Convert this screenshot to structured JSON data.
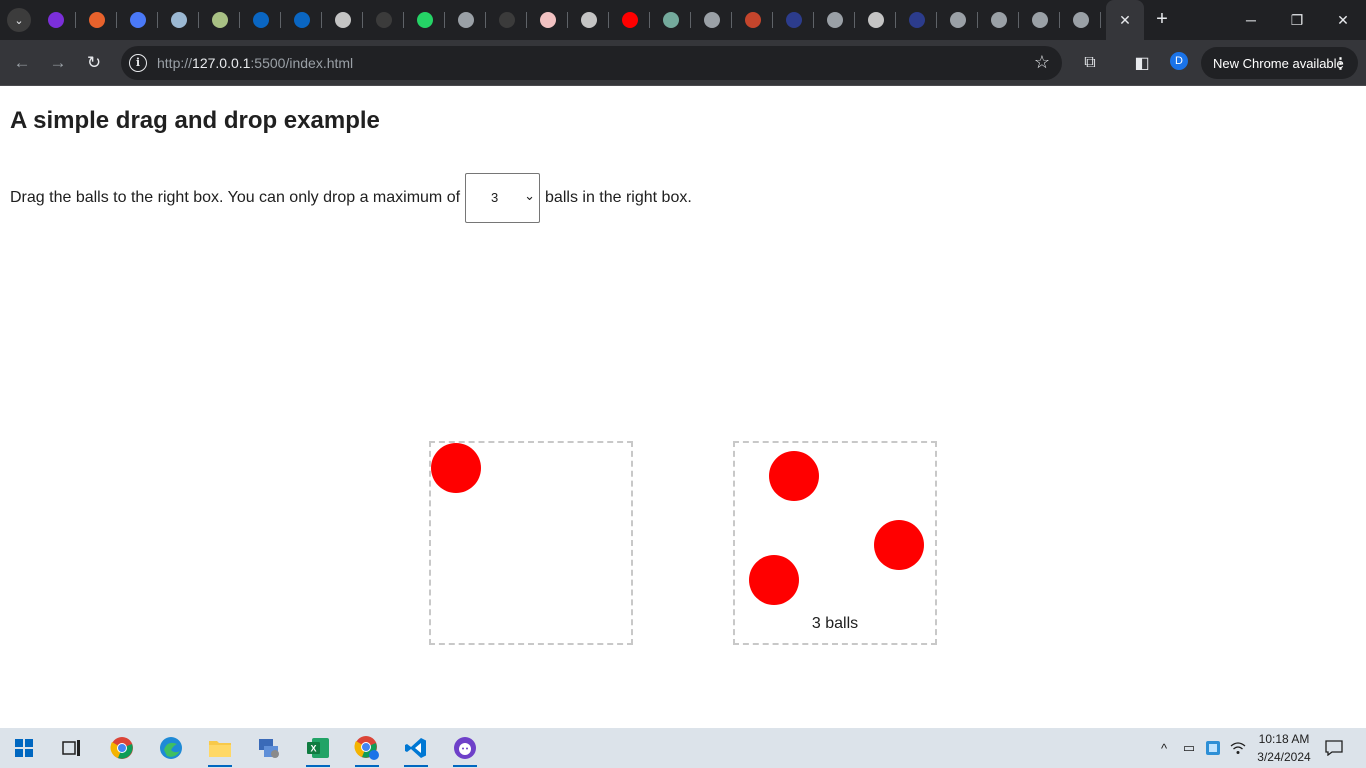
{
  "browser": {
    "tabs": [
      {
        "icon": "tab-list-icon"
      },
      {
        "icon": "mail-icon",
        "color": "#7b2fd9"
      },
      {
        "icon": "orange-circle-icon",
        "color": "#e8622c"
      },
      {
        "icon": "dots-icon",
        "color": "#4a79f7"
      },
      {
        "icon": "globe-icon",
        "color": "#9bb8d3"
      },
      {
        "icon": "globe-icon",
        "color": "#a8c084"
      },
      {
        "icon": "linkedin-icon",
        "color": "#0a66c2"
      },
      {
        "icon": "linkedin-icon",
        "color": "#0a66c2"
      },
      {
        "icon": "crosshair-icon",
        "color": "#c4c4c4"
      },
      {
        "icon": "github-icon",
        "color": "#3b3b3b"
      },
      {
        "icon": "whatsapp-icon",
        "color": "#25d366"
      },
      {
        "icon": "circle-icon",
        "color": "#9aa0a6"
      },
      {
        "icon": "github-icon",
        "color": "#3b3b3b"
      },
      {
        "icon": "image-icon",
        "color": "#f1c2c2"
      },
      {
        "icon": "globe-icon",
        "color": "#c4c4c4"
      },
      {
        "icon": "youtube-icon",
        "color": "#ff0000"
      },
      {
        "icon": "chatgpt-icon",
        "color": "#74aa9c"
      },
      {
        "icon": "circle-icon",
        "color": "#9aa0a6"
      },
      {
        "icon": "orange-circle-icon",
        "color": "#c4452c"
      },
      {
        "icon": "crown-icon",
        "color": "#2c3c8c"
      },
      {
        "icon": "circle-icon",
        "color": "#9aa0a6"
      },
      {
        "icon": "globe-icon",
        "color": "#c4c4c4"
      },
      {
        "icon": "crown-icon",
        "color": "#2c3c8c"
      },
      {
        "icon": "globe-icon",
        "color": "#9aa0a6"
      },
      {
        "icon": "globe-icon",
        "color": "#9aa0a6"
      },
      {
        "icon": "globe-icon",
        "color": "#9aa0a6"
      },
      {
        "icon": "globe-icon",
        "color": "#9aa0a6"
      }
    ],
    "active_tab_close": "✕",
    "new_tab": "+",
    "url_host": "127.0.0.1",
    "url_prefix": "http://",
    "url_suffix": ":5500/index.html",
    "profile_initial": "D",
    "update_label": "New Chrome available",
    "update_menu": "⋮"
  },
  "page": {
    "title": "A simple drag and drop example",
    "instruction_before": "Drag the balls to the right box. You can only drop a maximum of",
    "max_value": "3",
    "instruction_after": "balls in the right box.",
    "left_box": {
      "ball_count": 1
    },
    "right_box": {
      "ball_count": 3,
      "count_label": "3 balls"
    },
    "ball_color": "#ff0000"
  },
  "taskbar": {
    "apps": [
      {
        "name": "windows-start-icon"
      },
      {
        "name": "task-view-icon"
      },
      {
        "name": "chrome-icon"
      },
      {
        "name": "edge-icon"
      },
      {
        "name": "file-explorer-icon",
        "active": true
      },
      {
        "name": "network-app-icon"
      },
      {
        "name": "excel-icon",
        "active": true
      },
      {
        "name": "chrome-profile-icon",
        "active": true
      },
      {
        "name": "vscode-icon",
        "active": true
      },
      {
        "name": "github-desktop-icon",
        "active": true
      }
    ],
    "time": "10:18 AM",
    "date": "3/24/2024"
  }
}
